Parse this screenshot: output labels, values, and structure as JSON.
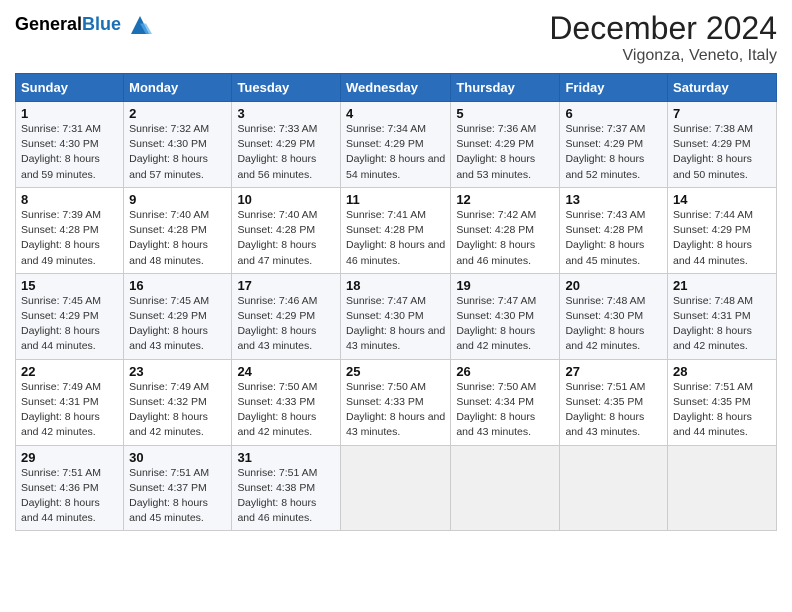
{
  "header": {
    "logo_general": "General",
    "logo_blue": "Blue",
    "title": "December 2024",
    "subtitle": "Vigonza, Veneto, Italy"
  },
  "days_of_week": [
    "Sunday",
    "Monday",
    "Tuesday",
    "Wednesday",
    "Thursday",
    "Friday",
    "Saturday"
  ],
  "weeks": [
    [
      {
        "day": 1,
        "sunrise": "7:31 AM",
        "sunset": "4:30 PM",
        "daylight": "8 hours and 59 minutes."
      },
      {
        "day": 2,
        "sunrise": "7:32 AM",
        "sunset": "4:30 PM",
        "daylight": "8 hours and 57 minutes."
      },
      {
        "day": 3,
        "sunrise": "7:33 AM",
        "sunset": "4:29 PM",
        "daylight": "8 hours and 56 minutes."
      },
      {
        "day": 4,
        "sunrise": "7:34 AM",
        "sunset": "4:29 PM",
        "daylight": "8 hours and 54 minutes."
      },
      {
        "day": 5,
        "sunrise": "7:36 AM",
        "sunset": "4:29 PM",
        "daylight": "8 hours and 53 minutes."
      },
      {
        "day": 6,
        "sunrise": "7:37 AM",
        "sunset": "4:29 PM",
        "daylight": "8 hours and 52 minutes."
      },
      {
        "day": 7,
        "sunrise": "7:38 AM",
        "sunset": "4:29 PM",
        "daylight": "8 hours and 50 minutes."
      }
    ],
    [
      {
        "day": 8,
        "sunrise": "7:39 AM",
        "sunset": "4:28 PM",
        "daylight": "8 hours and 49 minutes."
      },
      {
        "day": 9,
        "sunrise": "7:40 AM",
        "sunset": "4:28 PM",
        "daylight": "8 hours and 48 minutes."
      },
      {
        "day": 10,
        "sunrise": "7:40 AM",
        "sunset": "4:28 PM",
        "daylight": "8 hours and 47 minutes."
      },
      {
        "day": 11,
        "sunrise": "7:41 AM",
        "sunset": "4:28 PM",
        "daylight": "8 hours and 46 minutes."
      },
      {
        "day": 12,
        "sunrise": "7:42 AM",
        "sunset": "4:28 PM",
        "daylight": "8 hours and 46 minutes."
      },
      {
        "day": 13,
        "sunrise": "7:43 AM",
        "sunset": "4:28 PM",
        "daylight": "8 hours and 45 minutes."
      },
      {
        "day": 14,
        "sunrise": "7:44 AM",
        "sunset": "4:29 PM",
        "daylight": "8 hours and 44 minutes."
      }
    ],
    [
      {
        "day": 15,
        "sunrise": "7:45 AM",
        "sunset": "4:29 PM",
        "daylight": "8 hours and 44 minutes."
      },
      {
        "day": 16,
        "sunrise": "7:45 AM",
        "sunset": "4:29 PM",
        "daylight": "8 hours and 43 minutes."
      },
      {
        "day": 17,
        "sunrise": "7:46 AM",
        "sunset": "4:29 PM",
        "daylight": "8 hours and 43 minutes."
      },
      {
        "day": 18,
        "sunrise": "7:47 AM",
        "sunset": "4:30 PM",
        "daylight": "8 hours and 43 minutes."
      },
      {
        "day": 19,
        "sunrise": "7:47 AM",
        "sunset": "4:30 PM",
        "daylight": "8 hours and 42 minutes."
      },
      {
        "day": 20,
        "sunrise": "7:48 AM",
        "sunset": "4:30 PM",
        "daylight": "8 hours and 42 minutes."
      },
      {
        "day": 21,
        "sunrise": "7:48 AM",
        "sunset": "4:31 PM",
        "daylight": "8 hours and 42 minutes."
      }
    ],
    [
      {
        "day": 22,
        "sunrise": "7:49 AM",
        "sunset": "4:31 PM",
        "daylight": "8 hours and 42 minutes."
      },
      {
        "day": 23,
        "sunrise": "7:49 AM",
        "sunset": "4:32 PM",
        "daylight": "8 hours and 42 minutes."
      },
      {
        "day": 24,
        "sunrise": "7:50 AM",
        "sunset": "4:33 PM",
        "daylight": "8 hours and 42 minutes."
      },
      {
        "day": 25,
        "sunrise": "7:50 AM",
        "sunset": "4:33 PM",
        "daylight": "8 hours and 43 minutes."
      },
      {
        "day": 26,
        "sunrise": "7:50 AM",
        "sunset": "4:34 PM",
        "daylight": "8 hours and 43 minutes."
      },
      {
        "day": 27,
        "sunrise": "7:51 AM",
        "sunset": "4:35 PM",
        "daylight": "8 hours and 43 minutes."
      },
      {
        "day": 28,
        "sunrise": "7:51 AM",
        "sunset": "4:35 PM",
        "daylight": "8 hours and 44 minutes."
      }
    ],
    [
      {
        "day": 29,
        "sunrise": "7:51 AM",
        "sunset": "4:36 PM",
        "daylight": "8 hours and 44 minutes."
      },
      {
        "day": 30,
        "sunrise": "7:51 AM",
        "sunset": "4:37 PM",
        "daylight": "8 hours and 45 minutes."
      },
      {
        "day": 31,
        "sunrise": "7:51 AM",
        "sunset": "4:38 PM",
        "daylight": "8 hours and 46 minutes."
      },
      null,
      null,
      null,
      null
    ]
  ]
}
